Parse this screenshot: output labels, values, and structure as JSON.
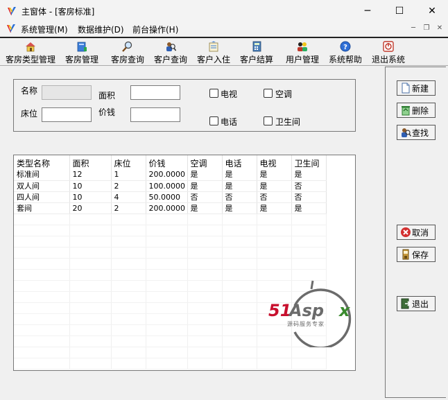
{
  "window": {
    "title": "主窗体 - [客房标准]",
    "controls": {
      "minimize": "─",
      "maximize": "☐",
      "close": "✕"
    }
  },
  "menubar": {
    "items": [
      "系统管理(M)",
      "数据维护(D)",
      "前台操作(H)"
    ],
    "mdi_controls": {
      "minimize": "─",
      "restore": "❐",
      "close": "✕"
    }
  },
  "toolbar": {
    "buttons": [
      {
        "label": "客房类型管理",
        "icon": "house-icon"
      },
      {
        "label": "客房管理",
        "icon": "book-icon"
      },
      {
        "label": "客房查询",
        "icon": "magnifier-icon"
      },
      {
        "label": "客户查询",
        "icon": "people-icon"
      },
      {
        "label": "客户入住",
        "icon": "checkin-icon"
      },
      {
        "label": "客户结算",
        "icon": "calculator-icon"
      },
      {
        "label": "用户管理",
        "icon": "users-icon"
      },
      {
        "label": "系统帮助",
        "icon": "help-icon"
      },
      {
        "label": "退出系统",
        "icon": "exit-icon"
      }
    ]
  },
  "form": {
    "name_label": "名称",
    "area_label": "面积",
    "bed_label": "床位",
    "price_label": "价钱",
    "name_value": "",
    "area_value": "",
    "bed_value": "",
    "price_value": "",
    "checkboxes": {
      "tv": "电视",
      "ac": "空调",
      "phone": "电话",
      "bath": "卫生间"
    }
  },
  "grid": {
    "columns": [
      "类型名称",
      "面积",
      "床位",
      "价钱",
      "空调",
      "电话",
      "电视",
      "卫生间"
    ],
    "rows": [
      [
        "标准间",
        "12",
        "1",
        "200.0000",
        "是",
        "是",
        "是",
        "是"
      ],
      [
        "双人间",
        "10",
        "2",
        "100.0000",
        "是",
        "是",
        "是",
        "否"
      ],
      [
        "四人间",
        "10",
        "4",
        "50.0000",
        "否",
        "否",
        "否",
        "否"
      ],
      [
        "套间",
        "20",
        "2",
        "200.0000",
        "是",
        "是",
        "是",
        "是"
      ]
    ]
  },
  "actions": {
    "new": "新建",
    "delete": "删除",
    "search": "查找",
    "cancel": "取消",
    "save": "保存",
    "exit": "退出"
  },
  "watermark": {
    "brand": "51Aspx",
    "tagline": "源码服务专家"
  },
  "colors": {
    "watermark_red": "#c8102e",
    "watermark_gray": "#6b6b6b",
    "watermark_green": "#3a8a2e"
  }
}
